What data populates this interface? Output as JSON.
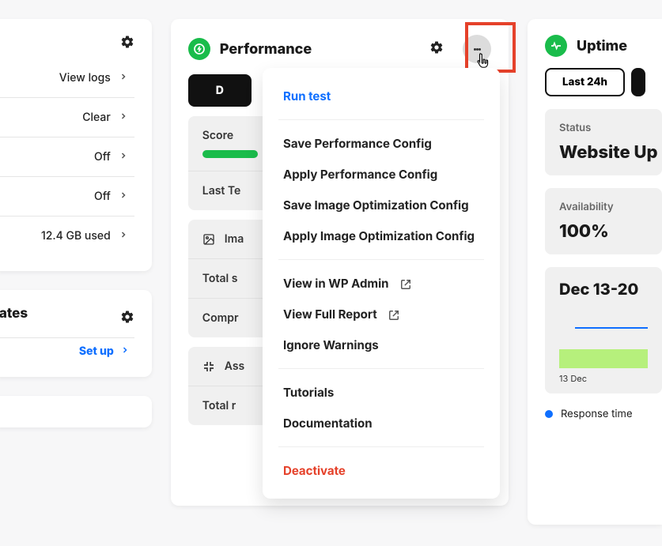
{
  "left_card1": {
    "rows": [
      {
        "label": "View logs"
      },
      {
        "label": "Clear"
      },
      {
        "label": "Off"
      },
      {
        "label": "Off"
      },
      {
        "label": "12.4 GB used"
      }
    ]
  },
  "left_card2": {
    "title_fragment": "lates",
    "setup_label": "Set up"
  },
  "performance": {
    "title": "Performance",
    "cta_fragment": "D",
    "rows": {
      "score_label": "Score",
      "last_test_label": "Last Te",
      "image_label": "Ima",
      "total_s_label": "Total s",
      "compr_label": "Compr",
      "assets_label": "Ass",
      "total_r_label": "Total r"
    },
    "menu": {
      "run_test": "Run test",
      "save_perf": "Save Performance Config",
      "apply_perf": "Apply Performance Config",
      "save_img": "Save Image Optimization Config",
      "apply_img": "Apply Image Optimization Config",
      "view_wp": "View in WP Admin",
      "view_report": "View Full Report",
      "ignore": "Ignore Warnings",
      "tutorials": "Tutorials",
      "docs": "Documentation",
      "deactivate": "Deactivate"
    }
  },
  "uptime": {
    "title": "Uptime",
    "range_label": "Last 24h",
    "status_label": "Status",
    "status_value": "Website Up",
    "avail_label": "Availability",
    "avail_value": "100%",
    "chart_title": "Dec 13-20",
    "tick0": "13 Dec",
    "legend_response": "Response time"
  },
  "chart_data": {
    "type": "line",
    "title": "Dec 13-20",
    "categories": [
      "13 Dec"
    ],
    "series": [
      {
        "name": "Response time",
        "kind": "line",
        "values_ms_approx": "flat line, value not labeled"
      },
      {
        "name": "Uptime",
        "kind": "band",
        "value": "up (100%)"
      }
    ],
    "note": "Only the leftmost tick label and legend entry are visible in the cropped screenshot; y-axis values are not shown."
  }
}
